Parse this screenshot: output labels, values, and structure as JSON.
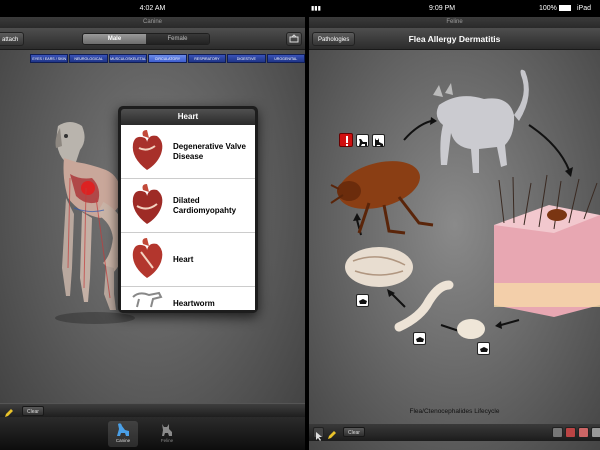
{
  "left": {
    "status": {
      "time": "4:02 AM"
    },
    "subtitle": "Canine",
    "navbar": {
      "back_label": "attach"
    },
    "gender": {
      "options": [
        "Male",
        "Female"
      ],
      "selected": "Male"
    },
    "systems": [
      {
        "label": "EYES / EARS / SKIN",
        "active": false
      },
      {
        "label": "NEUROLOGICAL",
        "active": false
      },
      {
        "label": "MUSCULOSKELETAL",
        "active": false
      },
      {
        "label": "CIRCULATORY",
        "active": true
      },
      {
        "label": "RESPIRATORY",
        "active": false
      },
      {
        "label": "DIGESTIVE",
        "active": false
      },
      {
        "label": "UROGENITAL",
        "active": false
      }
    ],
    "popover": {
      "title": "Heart",
      "items": [
        {
          "label": "Degenerative Valve Disease"
        },
        {
          "label": "Dilated Cardiomyopahty"
        },
        {
          "label": "Heart"
        },
        {
          "label": "Heartworm"
        }
      ]
    },
    "toolbar": {
      "clear_label": "Clear"
    },
    "tabbar": [
      {
        "label": "Canine",
        "selected": true
      },
      {
        "label": "Feline",
        "selected": false
      }
    ]
  },
  "right": {
    "status": {
      "time": "9:09 PM",
      "battery": "100%",
      "device": "iPad"
    },
    "subtitle": "Feline",
    "navbar": {
      "back_label": "Pathologies",
      "title": "Flea Allergy Dermatitis"
    },
    "caption": "Flea/Ctenocephalides Lifecycle",
    "toolbar": {
      "clear_label": "Clear"
    }
  },
  "colors": {
    "tab_blue": "#2a44a8",
    "tab_active": "#5577dd",
    "warning_red": "#d01010"
  }
}
